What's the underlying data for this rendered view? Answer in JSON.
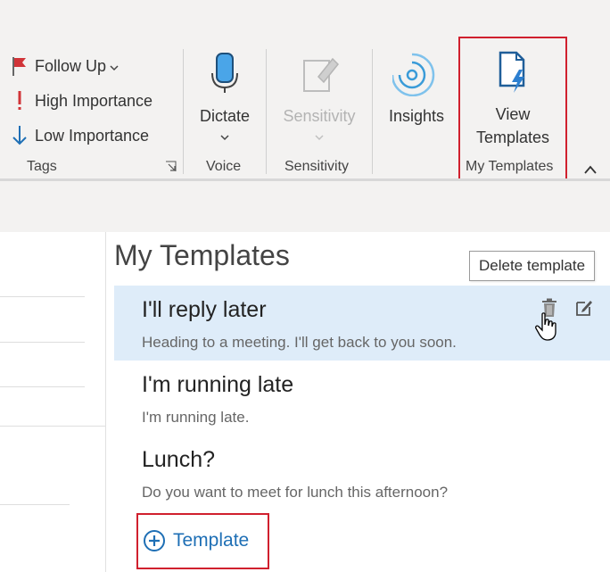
{
  "ribbon": {
    "tags": {
      "follow_up": "Follow Up",
      "high_importance": "High Importance",
      "low_importance": "Low Importance",
      "group_label": "Tags"
    },
    "voice": {
      "dictate": "Dictate",
      "group_label": "Voice"
    },
    "sensitivity": {
      "button": "Sensitivity",
      "group_label": "Sensitivity"
    },
    "insights": {
      "button": "Insights"
    },
    "my_templates": {
      "button_line1": "View",
      "button_line2": "Templates",
      "group_label": "My Templates"
    }
  },
  "templates_pane": {
    "title": "My Templates",
    "tooltip": "Delete template",
    "items": [
      {
        "heading": "I'll reply later",
        "body": "Heading to a meeting. I'll get back to you soon."
      },
      {
        "heading": "I'm running late",
        "body": "I'm running late."
      },
      {
        "heading": "Lunch?",
        "body": "Do you want to meet for lunch this afternoon?"
      }
    ],
    "add_label": "Template"
  },
  "colors": {
    "accent": "#1e6fb5",
    "highlight_red": "#d0202e",
    "selected_bg": "#deecf9",
    "flag_red": "#d13438"
  }
}
